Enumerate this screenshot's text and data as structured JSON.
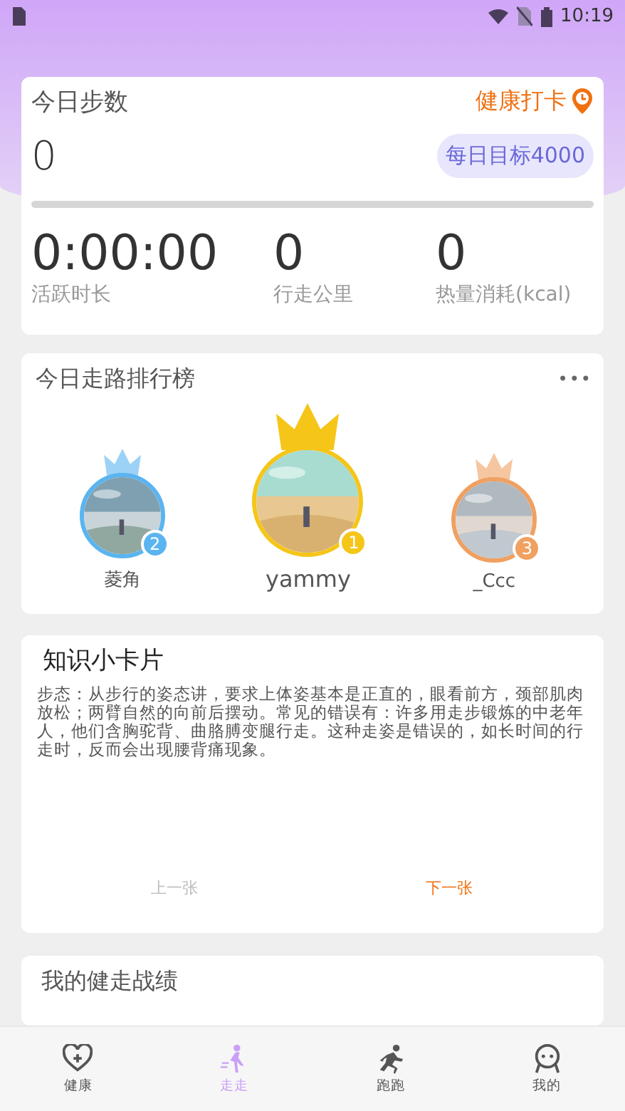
{
  "status_bar": {
    "time": "10:19"
  },
  "steps_card": {
    "title": "今日步数",
    "checkin": "健康打卡",
    "steps": "0",
    "goal": "每日目标4000",
    "level": 0,
    "stats": [
      {
        "value": "0:00:00",
        "label": "活跃时长"
      },
      {
        "value": "0",
        "label": "行走公里"
      },
      {
        "value": "0",
        "label": "热量消耗(kcal)"
      }
    ]
  },
  "ranking": {
    "title": "今日走路排行榜",
    "more": "•••",
    "entries": [
      {
        "rank": "2",
        "name": "菱角",
        "color": "#5ab4f0",
        "top": false
      },
      {
        "rank": "1",
        "name": "yammy",
        "color": "#f5c518",
        "top": true
      },
      {
        "rank": "3",
        "name": "_Ccc",
        "color": "#f0a060",
        "top": false
      }
    ]
  },
  "tip_card": {
    "title": "知识小卡片",
    "text": "步态：从步行的姿态讲，要求上体姿基本是正直的，眼看前方，颈部肌肉放松；两臂自然的向前后摆动。常见的错误有：许多用走步锻炼的中老年人，他们含胸驼背、曲胳膊变腿行走。这种走姿是错误的，如长时间的行走时，反而会出现腰背痛现象。",
    "prev": {
      "label": "上一张",
      "disabled": true
    },
    "next": {
      "label": "下一张",
      "disabled": false
    }
  },
  "records": {
    "title": "我的健走战绩"
  },
  "tabs": [
    {
      "label": "健康",
      "kind": "heart",
      "selected": false
    },
    {
      "label": "走走",
      "kind": "walk",
      "selected": true
    },
    {
      "label": "跑跑",
      "kind": "run",
      "selected": false
    },
    {
      "label": "我的",
      "kind": "face",
      "selected": false
    }
  ]
}
